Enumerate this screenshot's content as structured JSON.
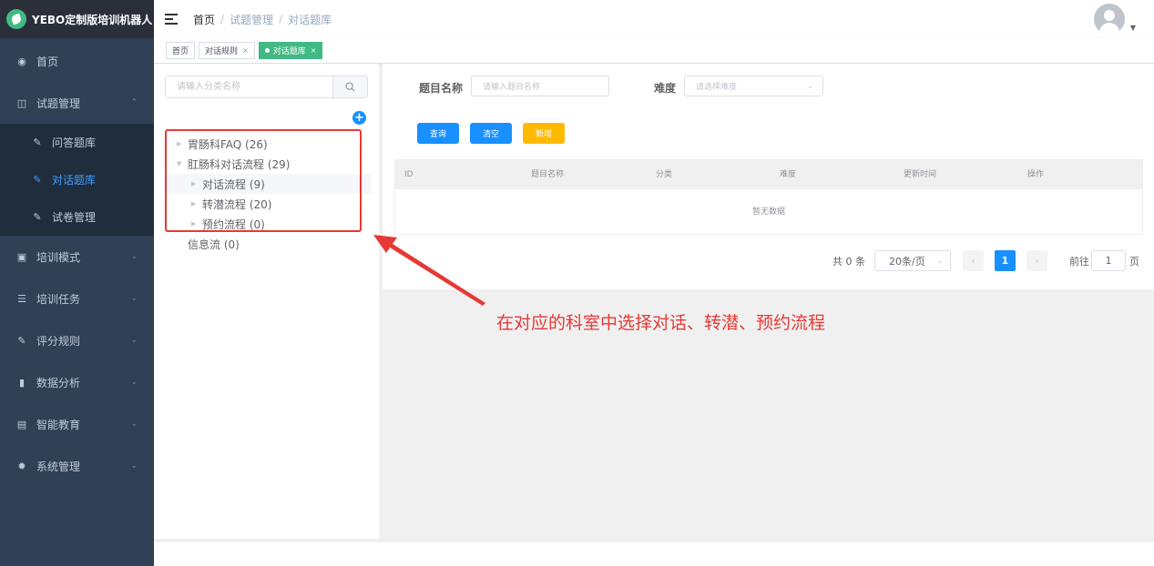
{
  "brand": {
    "title": "YEBO定制版培训机器人"
  },
  "sidebar": {
    "items": [
      {
        "label": "首页",
        "icon": "dashboard-icon"
      },
      {
        "label": "试题管理",
        "icon": "book-icon",
        "expanded": true,
        "children": [
          {
            "label": "问答题库",
            "icon": "edit-icon"
          },
          {
            "label": "对话题库",
            "icon": "edit-icon",
            "active": true
          },
          {
            "label": "试卷管理",
            "icon": "edit-icon"
          }
        ]
      },
      {
        "label": "培训模式",
        "icon": "monitor-icon"
      },
      {
        "label": "培训任务",
        "icon": "list-icon"
      },
      {
        "label": "评分规则",
        "icon": "edit-icon"
      },
      {
        "label": "数据分析",
        "icon": "chart-icon"
      },
      {
        "label": "智能教育",
        "icon": "education-icon"
      },
      {
        "label": "系统管理",
        "icon": "gear-icon"
      }
    ],
    "active_color": "#409eff"
  },
  "header": {
    "breadcrumb": [
      "首页",
      "试题管理",
      "对话题库"
    ],
    "separator": "/"
  },
  "tags": [
    {
      "label": "首页",
      "closable": false,
      "active": false
    },
    {
      "label": "对话规则",
      "closable": true,
      "active": false
    },
    {
      "label": "对话题库",
      "closable": true,
      "active": true
    }
  ],
  "tree_panel": {
    "search_placeholder": "请输入分类名称",
    "nodes": [
      {
        "label": "胃肠科FAQ (26)",
        "level": 0,
        "expanded": false
      },
      {
        "label": "肛肠科对话流程 (29)",
        "level": 0,
        "expanded": true
      },
      {
        "label": "对话流程 (9)",
        "level": 1,
        "expanded": false
      },
      {
        "label": "转潜流程 (20)",
        "level": 1,
        "expanded": false
      },
      {
        "label": "预约流程 (0)",
        "level": 1,
        "expanded": false
      },
      {
        "label": "信息流 (0)",
        "level": 0,
        "leaf": true
      }
    ]
  },
  "filter": {
    "name_label": "题目名称",
    "name_placeholder": "请输入题目名称",
    "difficulty_label": "难度",
    "difficulty_placeholder": "请选择难度",
    "search_button": "查询",
    "clear_button": "清空",
    "add_button": "新增"
  },
  "table": {
    "columns": [
      "ID",
      "题目名称",
      "分类",
      "难度",
      "更新时间",
      "操作"
    ],
    "rows": [],
    "empty_text": "暂无数据"
  },
  "pagination": {
    "total_text": "共 0 条",
    "page_size": "20条/页",
    "current_page": "1",
    "goto_label": "前往",
    "goto_value": "1",
    "page_unit": "页"
  },
  "annotation": {
    "text": "在对应的科室中选择对话、转潜、预约流程",
    "color": "#e53935"
  },
  "colors": {
    "sidebar_bg": "#304156",
    "primary": "#1890ff",
    "tag_active": "#42b983",
    "warning": "#ffba00"
  }
}
